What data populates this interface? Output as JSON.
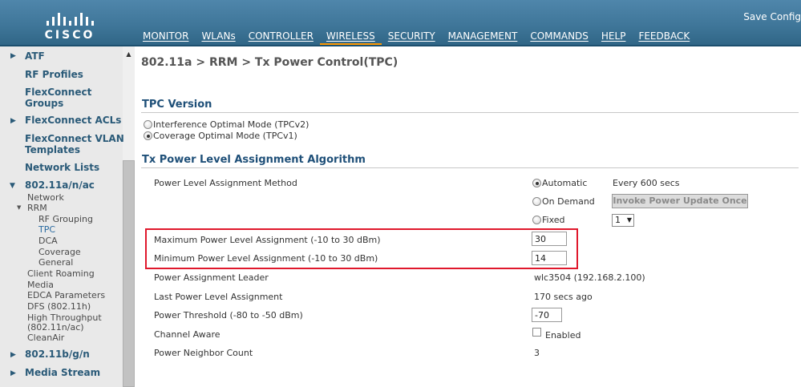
{
  "header": {
    "brand": "CISCO",
    "save_config": "Save Config",
    "nav": [
      "MONITOR",
      "WLANs",
      "CONTROLLER",
      "WIRELESS",
      "SECURITY",
      "MANAGEMENT",
      "COMMANDS",
      "HELP",
      "FEEDBACK"
    ],
    "active_nav": "WIRELESS",
    "colors": {
      "header": "#3f7699",
      "active_tab": "#ff9900"
    }
  },
  "sidebar": {
    "items": {
      "atf": "ATF",
      "rf_profiles": "RF Profiles",
      "flexconnect_groups_1": "FlexConnect",
      "flexconnect_groups_2": "Groups",
      "flexconnect_acls": "FlexConnect ACLs",
      "flexconnect_vlan_1": "FlexConnect VLAN",
      "flexconnect_vlan_2": "Templates",
      "network_lists": "Network Lists",
      "a_band": "802.11a/n/ac",
      "network": "Network",
      "rrm": "RRM",
      "rf_grouping": "RF Grouping",
      "tpc": "TPC",
      "dca": "DCA",
      "coverage": "Coverage",
      "general": "General",
      "client_roaming": "Client Roaming",
      "media": "Media",
      "edca": "EDCA Parameters",
      "dfs": "DFS (802.11h)",
      "high_throughput_1": "High Throughput",
      "high_throughput_2": "(802.11n/ac)",
      "cleanair": "CleanAir",
      "bg_band": "802.11b/g/n",
      "media_stream": "Media Stream"
    }
  },
  "main": {
    "breadcrumb": "802.11a > RRM > Tx Power Control(TPC)",
    "tpc_version": {
      "heading": "TPC Version",
      "options": [
        "Interference Optimal Mode (TPCv2)",
        "Coverage Optimal Mode (TPCv1)"
      ],
      "selected": "Coverage Optimal Mode (TPCv1)"
    },
    "algorithm": {
      "heading": "Tx Power Level Assignment Algorithm",
      "method_label": "Power Level Assignment Method",
      "method_options": {
        "automatic": "Automatic",
        "on_demand": "On Demand",
        "fixed": "Fixed"
      },
      "method_selected": "Automatic",
      "interval": "Every 600 secs",
      "invoke_button": "Invoke Power Update Once",
      "fixed_value": "1",
      "max_label": "Maximum Power Level Assignment (-10 to 30 dBm)",
      "max_value": "30",
      "min_label": "Minimum Power Level Assignment (-10 to 30 dBm)",
      "min_value": "14",
      "leader_label": "Power Assignment Leader",
      "leader_value": "wlc3504 (192.168.2.100)",
      "last_label": "Last Power Level Assignment",
      "last_value": "170 secs ago",
      "threshold_label": "Power Threshold (-80 to -50 dBm)",
      "threshold_value": "-70",
      "channel_aware_label": "Channel Aware",
      "channel_aware_text": "Enabled",
      "channel_aware_checked": false,
      "neighbor_label": "Power Neighbor Count",
      "neighbor_value": "3"
    },
    "highlight_color": "#e0182c"
  }
}
